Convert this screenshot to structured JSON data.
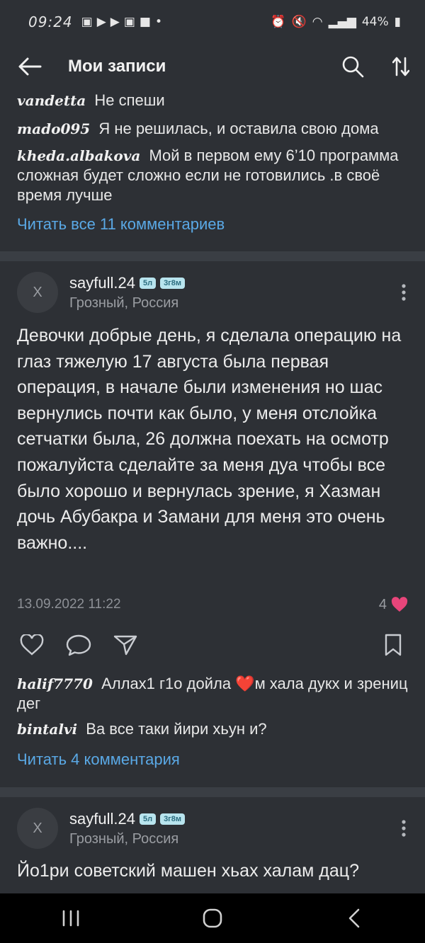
{
  "status": {
    "time": "09:24",
    "battery": "44%"
  },
  "appbar": {
    "title": "Мои записи"
  },
  "top_comments": [
    {
      "user": "vandetta",
      "text": "Не спеши"
    },
    {
      "user": "mado095",
      "text": "Я не решилась, и оставила свою дома"
    },
    {
      "user": "kheda.albakova",
      "text": "Мой в первом ему 6’10 программа сложная будет сложно если не готовились .в своё время лучше"
    }
  ],
  "top_read_all": "Читать все 11 комментариев",
  "post1": {
    "avatar_letter": "X",
    "author": "sayfull.24",
    "badge1": "5л",
    "badge2": "3г8м",
    "location": "Грозный, Россия",
    "body": "Девочки добрые день,  я сделала операцию на глаз тяжелую 17 августа была первая операция, в начале были изменения но шас вернулись почти как было,  у меня отслойка сетчатки была, 26 должна поехать на осмотр пожалуйста сделайте за  меня дуа чтобы все было хорошо и вернулась зрение,  я Хазман дочь Абубакра  и Замани для меня это очень важно....",
    "date": "13.09.2022 11:22",
    "likes": "4",
    "comments": [
      {
        "user": "halif7770",
        "text": "Аллах1 г1о дойла ❤️м хала дукх и зрениц дег"
      },
      {
        "user": "bintalvi",
        "text": "Ва все таки йири хьун и?"
      }
    ],
    "read_all": "Читать 4 комментария"
  },
  "post2": {
    "avatar_letter": "X",
    "author": "sayfull.24",
    "badge1": "5л",
    "badge2": "3г8м",
    "location": "Грозный, Россия",
    "body": "Йо1ри советский машен хьах халам дац?"
  },
  "colors": {
    "background": "#2d3035",
    "accent_link": "#5aa9e6",
    "like_heart": "#e8457a"
  }
}
